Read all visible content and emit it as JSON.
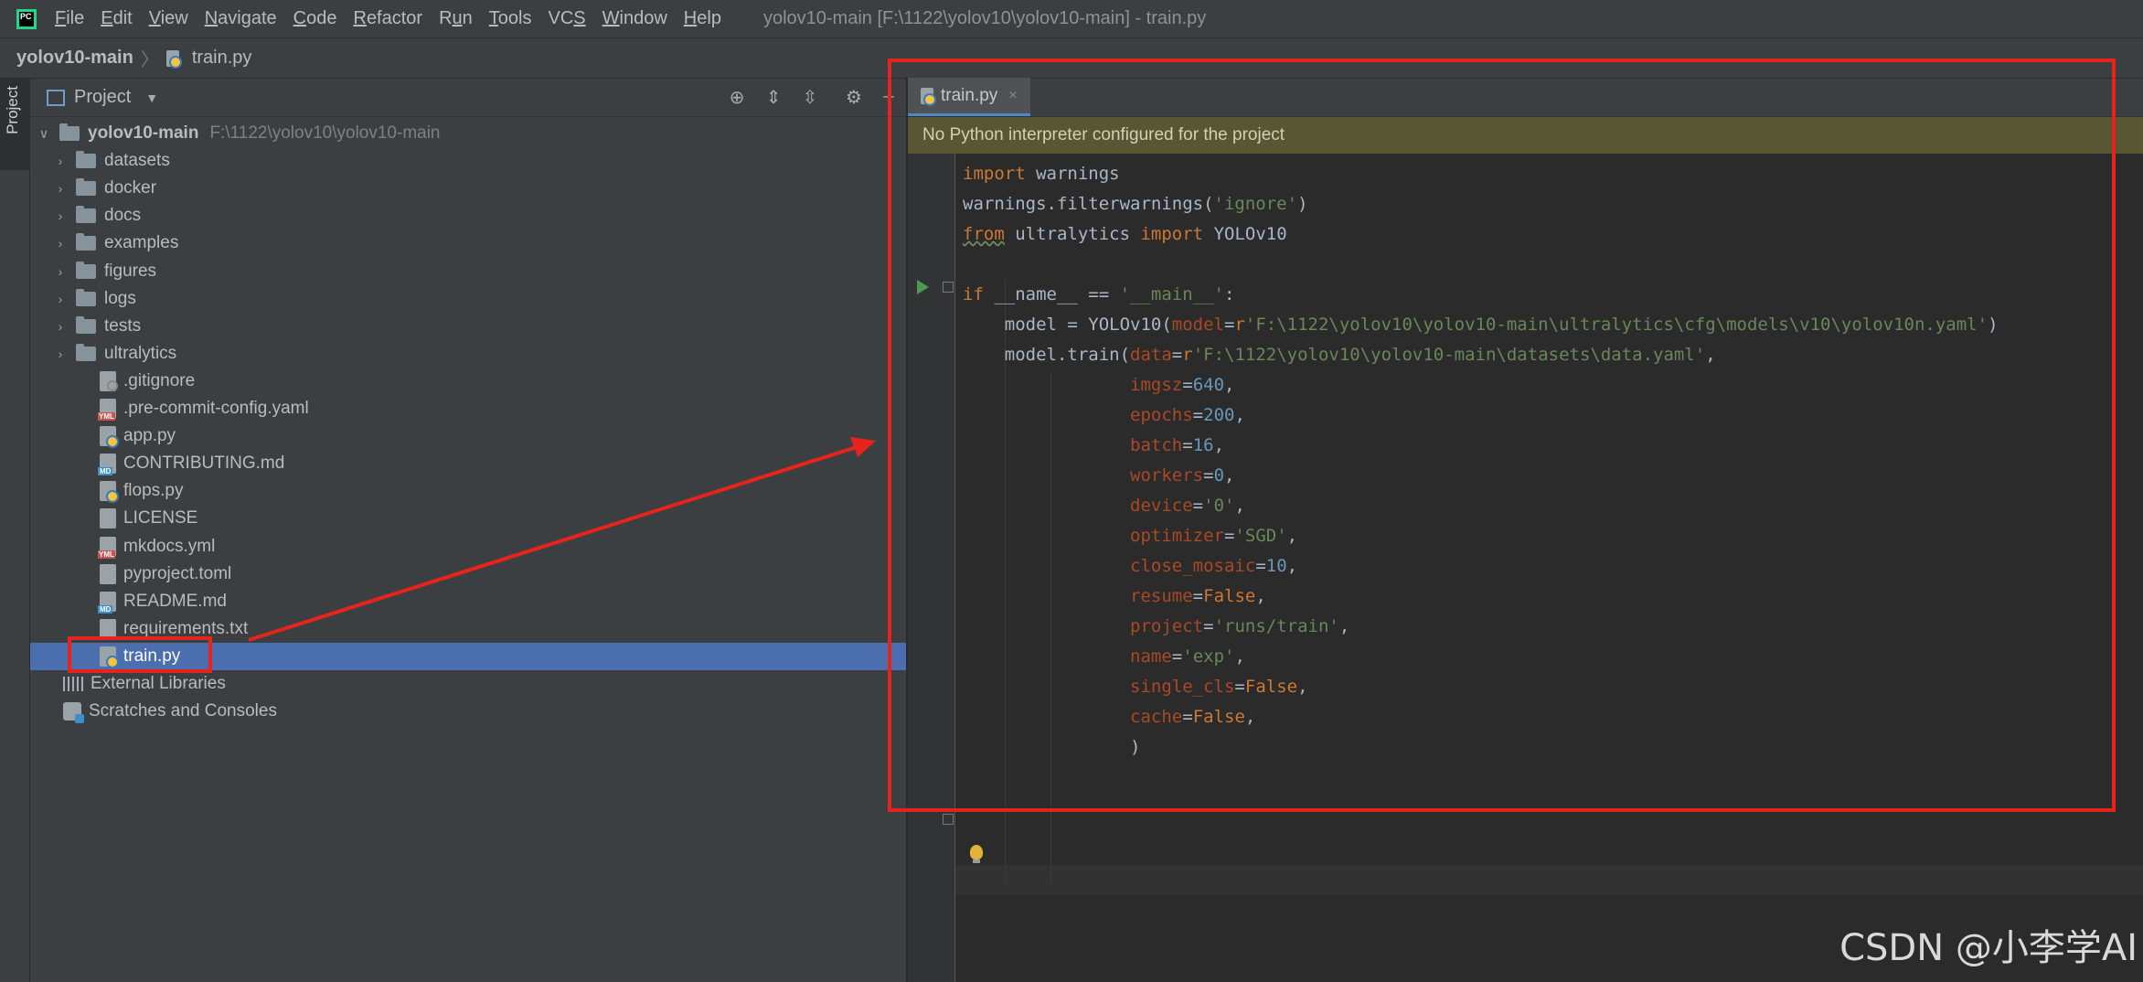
{
  "menubar": {
    "items": [
      {
        "label": "File",
        "mnemonic": "F"
      },
      {
        "label": "Edit",
        "mnemonic": "E"
      },
      {
        "label": "View",
        "mnemonic": "V"
      },
      {
        "label": "Navigate",
        "mnemonic": "N"
      },
      {
        "label": "Code",
        "mnemonic": "C"
      },
      {
        "label": "Refactor",
        "mnemonic": "R"
      },
      {
        "label": "Run",
        "mnemonic": "u"
      },
      {
        "label": "Tools",
        "mnemonic": "T"
      },
      {
        "label": "VCS",
        "mnemonic": "S"
      },
      {
        "label": "Window",
        "mnemonic": "W"
      },
      {
        "label": "Help",
        "mnemonic": "H"
      }
    ],
    "window_title": "yolov10-main [F:\\1122\\yolov10\\yolov10-main] - train.py",
    "logo_text": "PC"
  },
  "breadcrumb": {
    "project": "yolov10-main",
    "file": "train.py"
  },
  "tool_strip": {
    "label": "Project"
  },
  "project_panel": {
    "title": "Project",
    "root": {
      "name": "yolov10-main",
      "path": "F:\\1122\\yolov10\\yolov10-main"
    },
    "folders": [
      "datasets",
      "docker",
      "docs",
      "examples",
      "figures",
      "logs",
      "tests",
      "ultralytics"
    ],
    "files": [
      {
        "name": ".gitignore",
        "type": "ignore"
      },
      {
        "name": ".pre-commit-config.yaml",
        "type": "yml"
      },
      {
        "name": "app.py",
        "type": "py"
      },
      {
        "name": "CONTRIBUTING.md",
        "type": "md"
      },
      {
        "name": "flops.py",
        "type": "py"
      },
      {
        "name": "LICENSE",
        "type": "text"
      },
      {
        "name": "mkdocs.yml",
        "type": "yml"
      },
      {
        "name": "pyproject.toml",
        "type": "text"
      },
      {
        "name": "README.md",
        "type": "md"
      },
      {
        "name": "requirements.txt",
        "type": "text"
      },
      {
        "name": "train.py",
        "type": "py",
        "selected": true
      }
    ],
    "external_libraries": "External Libraries",
    "scratches": "Scratches and Consoles"
  },
  "editor": {
    "tab_label": "train.py",
    "tab_close": "×",
    "warning": "No Python interpreter configured for the project"
  },
  "code": {
    "lines": [
      "import warnings",
      "warnings.filterwarnings('ignore')",
      "from ultralytics import YOLOv10",
      "",
      "if __name__ == '__main__':",
      "    model = YOLOv10(model=r'F:\\1122\\yolov10\\yolov10-main\\ultralytics\\cfg\\models\\v10\\yolov10n.yaml')",
      "    model.train(data=r'F:\\1122\\yolov10\\yolov10-main\\datasets\\data.yaml',",
      "                imgsz=640,",
      "                epochs=200,",
      "                batch=16,",
      "                workers=0,",
      "                device='0',",
      "                optimizer='SGD',",
      "                close_mosaic=10,",
      "                resume=False,",
      "                project='runs/train',",
      "                name='exp',",
      "                single_cls=False,",
      "                cache=False,",
      "                )",
      ""
    ]
  },
  "watermark": "CSDN @小李学AI",
  "colors": {
    "annotation": "#e8231c",
    "selection": "#4b6eaf",
    "keyword": "#cc7832",
    "string": "#6a8759",
    "number": "#6897bb",
    "param": "#aa4926"
  }
}
